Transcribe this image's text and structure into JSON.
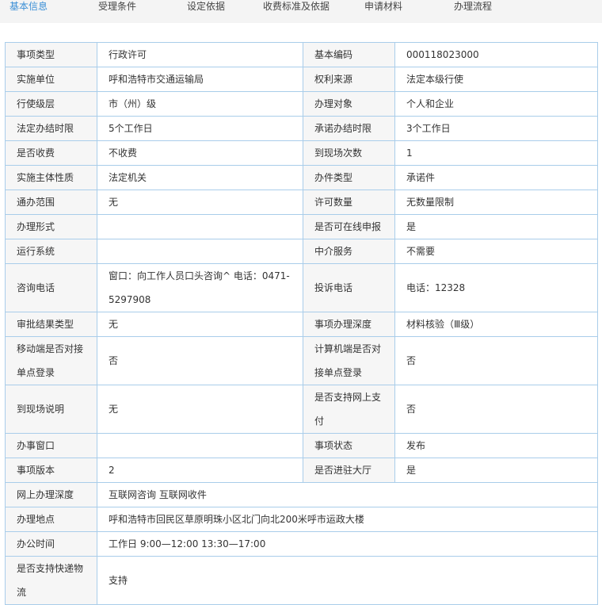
{
  "tabs": [
    "基本信息",
    "受理条件",
    "设定依据",
    "收费标准及依据",
    "申请材料",
    "办理流程"
  ],
  "rows": [
    [
      "事项类型",
      "行政许可",
      "基本编码",
      "000118023000"
    ],
    [
      "实施单位",
      "呼和浩特市交通运输局",
      "权利来源",
      "法定本级行使"
    ],
    [
      "行使级层",
      "市（州）级",
      "办理对象",
      "个人和企业"
    ],
    [
      "法定办结时限",
      "5个工作日",
      "承诺办结时限",
      "3个工作日"
    ],
    [
      "是否收费",
      "不收费",
      "到现场次数",
      "1"
    ],
    [
      "实施主体性质",
      "法定机关",
      "办件类型",
      "承诺件"
    ],
    [
      "通办范围",
      "无",
      "许可数量",
      "无数量限制"
    ],
    [
      "办理形式",
      "",
      "是否可在线申报",
      "是"
    ],
    [
      "运行系统",
      "",
      "中介服务",
      "不需要"
    ],
    [
      "咨询电话",
      "窗口：向工作人员口头咨询^ 电话：0471-5297908",
      "投诉电话",
      "电话：12328"
    ],
    [
      "审批结果类型",
      "无",
      "事项办理深度",
      "材料核验（Ⅲ级）"
    ],
    [
      "移动端是否对接单点登录",
      "否",
      "计算机端是否对接单点登录",
      "否"
    ],
    [
      "到现场说明",
      "无",
      "是否支持网上支付",
      "否"
    ],
    [
      "办事窗口",
      "",
      "事项状态",
      "发布"
    ],
    [
      "事项版本",
      "2",
      "是否进驻大厅",
      "是"
    ]
  ],
  "wide_rows": [
    [
      "网上办理深度",
      "互联网咨询 互联网收件"
    ],
    [
      "办理地点",
      "呼和浩特市回民区草原明珠小区北门向北200米呼市运政大楼"
    ],
    [
      "办公时间",
      "工作日 9:00—12:00 13:30—17:00"
    ],
    [
      "是否支持快递物流",
      "支持"
    ]
  ]
}
